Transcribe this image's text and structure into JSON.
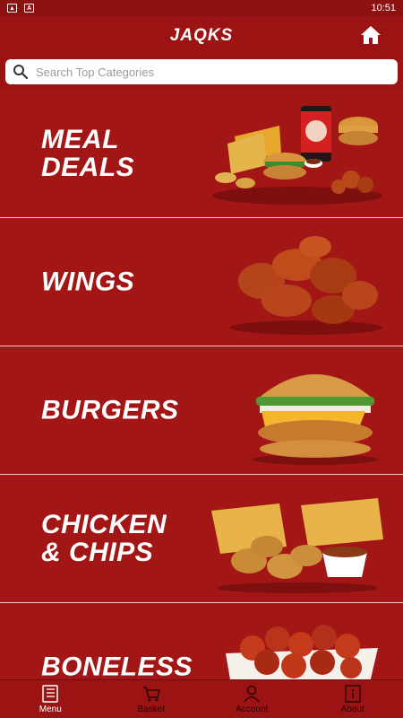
{
  "status": {
    "time": "10:51"
  },
  "header": {
    "logo": "JAQKS"
  },
  "search": {
    "placeholder": "Search Top Categories"
  },
  "categories": [
    {
      "label": "MEAL\nDEALS",
      "image": "meal-deal-image"
    },
    {
      "label": "WINGS",
      "image": "wings-image"
    },
    {
      "label": "BURGERS",
      "image": "burger-image"
    },
    {
      "label": "CHICKEN\n& CHIPS",
      "image": "chicken-chips-image"
    },
    {
      "label": "BONELESS",
      "image": "boneless-image"
    }
  ],
  "tabs": [
    {
      "label": "Menu",
      "icon": "menu-book-icon",
      "active": true
    },
    {
      "label": "Basket",
      "icon": "basket-icon",
      "active": false
    },
    {
      "label": "Account",
      "icon": "account-icon",
      "active": false
    },
    {
      "label": "About",
      "icon": "info-icon",
      "active": false
    }
  ],
  "colors": {
    "brand_red": "#9b1313",
    "text_white": "#ffffff",
    "tab_inactive": "#2a0505"
  }
}
